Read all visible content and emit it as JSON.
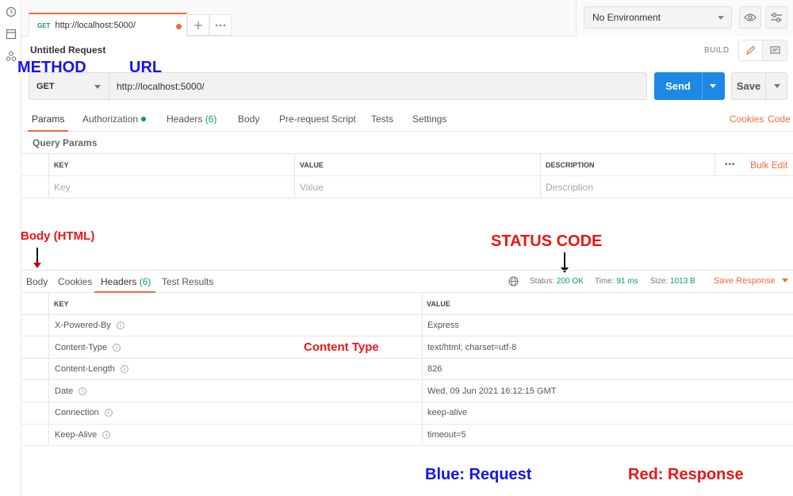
{
  "tab": {
    "method": "GET",
    "url": "http://localhost:5000/"
  },
  "environment": {
    "selected": "No Environment"
  },
  "request": {
    "name": "Untitled Request",
    "build_label": "BUILD",
    "method": "GET",
    "url": "http://localhost:5000/",
    "send_label": "Send",
    "save_label": "Save"
  },
  "request_tabs": {
    "params": "Params",
    "authorization": "Authorization",
    "headers": "Headers",
    "headers_count": "(6)",
    "body": "Body",
    "prerequest": "Pre-request Script",
    "tests": "Tests",
    "settings": "Settings",
    "cookies": "Cookies",
    "code": "Code"
  },
  "query_params": {
    "title": "Query Params",
    "col_key": "KEY",
    "col_value": "VALUE",
    "col_description": "DESCRIPTION",
    "bulk_edit": "Bulk Edit",
    "more": "•••",
    "placeholder_key": "Key",
    "placeholder_value": "Value",
    "placeholder_description": "Description"
  },
  "response": {
    "tabs": {
      "body": "Body",
      "cookies": "Cookies",
      "headers": "Headers",
      "headers_count": "(6)",
      "test_results": "Test Results"
    },
    "status_label": "Status:",
    "status_value": "200 OK",
    "time_label": "Time:",
    "time_value": "91 ms",
    "size_label": "Size:",
    "size_value": "1013 B",
    "save_response": "Save Response",
    "col_key": "KEY",
    "col_value": "VALUE",
    "headers": [
      {
        "key": "X-Powered-By",
        "value": "Express"
      },
      {
        "key": "Content-Type",
        "value": "text/html; charset=utf-8"
      },
      {
        "key": "Content-Length",
        "value": "826"
      },
      {
        "key": "Date",
        "value": "Wed, 09 Jun 2021 16:12:15 GMT"
      },
      {
        "key": "Connection",
        "value": "keep-alive"
      },
      {
        "key": "Keep-Alive",
        "value": "timeout=5"
      }
    ]
  },
  "annotations": {
    "method": "METHOD",
    "url": "URL",
    "body_html": "Body (HTML)",
    "status_code": "STATUS CODE",
    "content_type": "Content Type",
    "legend_blue": "Blue: Request",
    "legend_red": "Red: Response",
    "blue_color": "#1414ee",
    "red_color": "#ee1414"
  },
  "colors": {
    "accent": "#f26b3a",
    "send": "#1e88e5",
    "success": "#0f9d58"
  }
}
